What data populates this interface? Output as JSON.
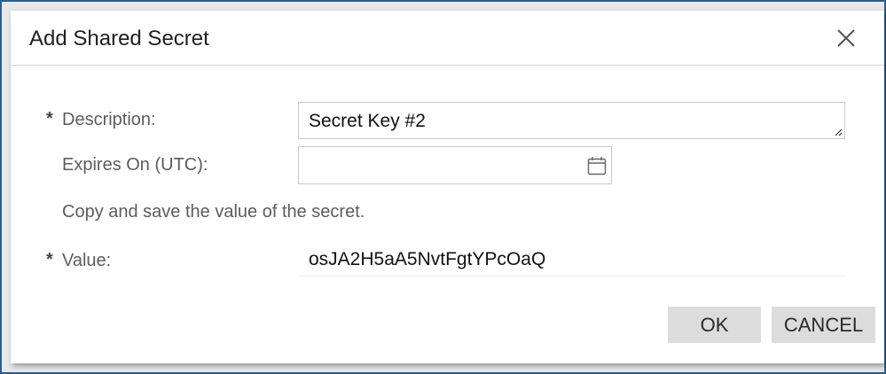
{
  "dialog": {
    "title": "Add Shared Secret",
    "close_icon": "close-icon"
  },
  "form": {
    "required_marker": "*",
    "description": {
      "label": "Description:",
      "value": "Secret Key #2",
      "required": true
    },
    "expires_on": {
      "label": "Expires On (UTC):",
      "value": "",
      "placeholder": "",
      "icon": "calendar-icon"
    },
    "hint": "Copy and save the value of the secret.",
    "value_field": {
      "label": "Value:",
      "value": "osJA2H5aA5NvtFgtYPcOaQ",
      "required": true
    }
  },
  "buttons": {
    "ok_label": "OK",
    "cancel_label": "CANCEL"
  },
  "colors": {
    "frame_border": "#2f5d86",
    "button_bg": "#dcdcdc",
    "label_text": "#5c5c5c"
  }
}
